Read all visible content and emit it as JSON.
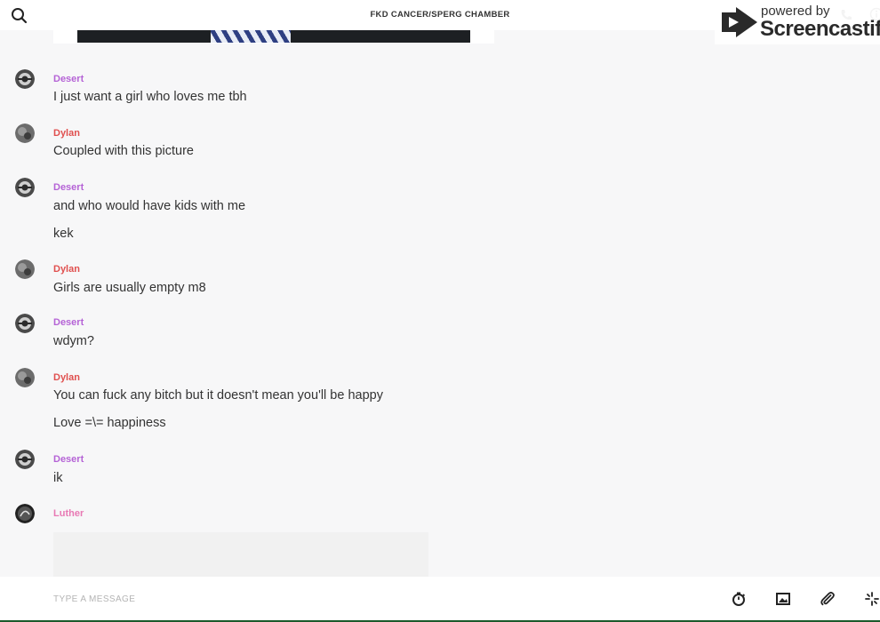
{
  "header": {
    "title": "FKD CANCER/SPERG CHAMBER"
  },
  "watermark": {
    "line1": "powered by",
    "line2": "Screencastify"
  },
  "messages": [
    {
      "author": "Desert",
      "text": "I just want a girl who loves me tbh"
    },
    {
      "author": "Dylan",
      "text": "Coupled with this picture"
    },
    {
      "author": "Desert",
      "text": "and who would have kids with me"
    },
    {
      "text": "kek"
    },
    {
      "author": "Dylan",
      "text": "Girls are usually empty m8"
    },
    {
      "author": "Desert",
      "text": "wdym?"
    },
    {
      "author": "Dylan",
      "text": "You can fuck any bitch but it doesn't mean you'll be happy"
    },
    {
      "text": "Love =\\= happiness"
    },
    {
      "author": "Desert",
      "text": "ik"
    },
    {
      "author": "Luther"
    }
  ],
  "author_colors": {
    "Desert": "#b563d6",
    "Dylan": "#e0504f",
    "Luther": "#e879b4"
  },
  "composer": {
    "placeholder": "TYPE A MESSAGE",
    "value": ""
  },
  "toolbar_icons": [
    "timer-icon",
    "image-icon",
    "paperclip-icon",
    "sparkle-icon"
  ]
}
